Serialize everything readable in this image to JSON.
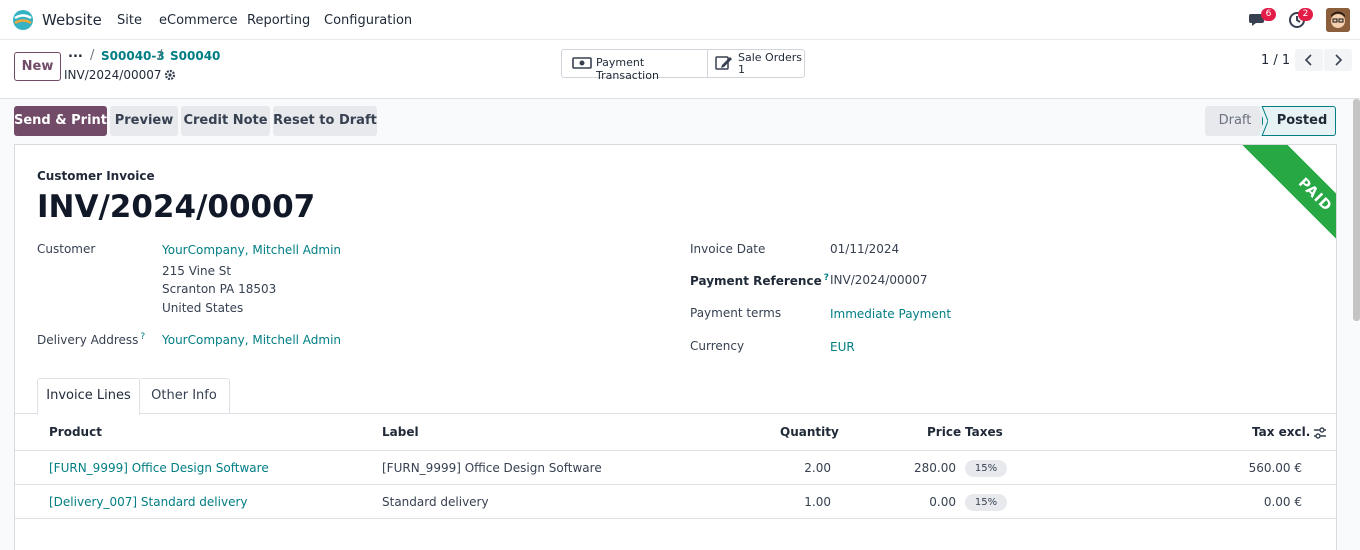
{
  "nav": {
    "app_name": "Website",
    "menu": [
      "Site",
      "eCommerce",
      "Reporting",
      "Configuration"
    ],
    "messages_count": "6",
    "activities_count": "2"
  },
  "control": {
    "new_label": "New",
    "breadcrumb_dots": "...",
    "breadcrumbs": [
      "S00040-3",
      "S00040"
    ],
    "record_name": "INV/2024/00007",
    "smart_buttons": {
      "payment_transaction": "Payment Transaction",
      "sale_orders_label": "Sale Orders",
      "sale_orders_count": "1"
    },
    "pager": "1 / 1"
  },
  "actions": {
    "send_print": "Send & Print",
    "preview": "Preview",
    "credit_note": "Credit Note",
    "reset_draft": "Reset to Draft"
  },
  "statusbar": {
    "draft": "Draft",
    "posted": "Posted"
  },
  "ribbon": "PAID",
  "form": {
    "type_label": "Customer Invoice",
    "title": "INV/2024/00007",
    "customer_label": "Customer",
    "customer_name": "YourCompany, Mitchell Admin",
    "address": [
      "215 Vine St",
      "Scranton PA 18503",
      "United States"
    ],
    "delivery_label": "Delivery Address",
    "delivery_value": "YourCompany, Mitchell Admin",
    "invoice_date_label": "Invoice Date",
    "invoice_date": "01/11/2024",
    "payment_ref_label": "Payment Reference",
    "payment_ref": "INV/2024/00007",
    "payment_terms_label": "Payment terms",
    "payment_terms": "Immediate Payment",
    "currency_label": "Currency",
    "currency": "EUR",
    "help_mark": "?"
  },
  "tabs": [
    "Invoice Lines",
    "Other Info"
  ],
  "table": {
    "headers": {
      "product": "Product",
      "label": "Label",
      "quantity": "Quantity",
      "price": "Price",
      "taxes": "Taxes",
      "tax_excl": "Tax excl."
    },
    "rows": [
      {
        "product": "[FURN_9999] Office Design Software",
        "label": "[FURN_9999] Office Design Software",
        "quantity": "2.00",
        "price": "280.00",
        "tax": "15%",
        "subtotal": "560.00 €"
      },
      {
        "product": "[Delivery_007] Standard delivery",
        "label": "Standard delivery",
        "quantity": "1.00",
        "price": "0.00",
        "tax": "15%",
        "subtotal": "0.00 €"
      }
    ]
  },
  "colors": {
    "primary": "#714b67",
    "link": "#017e84",
    "ribbon": "#28a745",
    "badge": "#e11d48"
  }
}
